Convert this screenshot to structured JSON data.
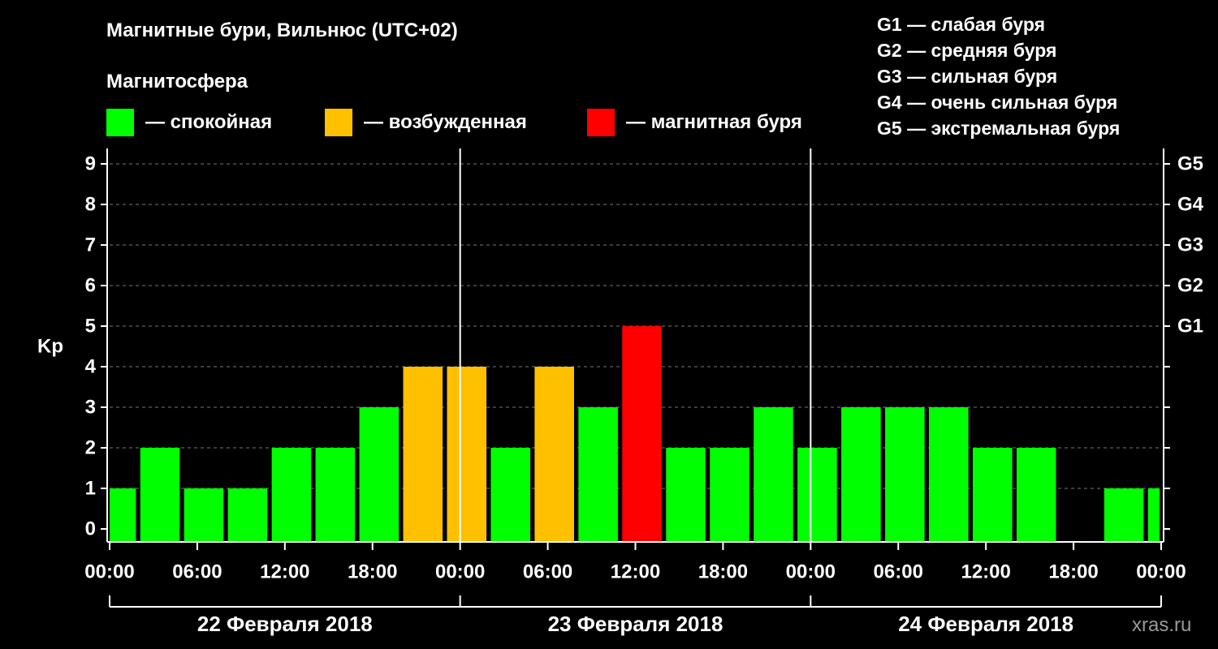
{
  "header": {
    "title": "Магнитные бури, Вильнюс (UTC+02)",
    "subtitle": "Магнитосфера"
  },
  "legend": [
    {
      "label": "— спокойная",
      "color": "#00ff00"
    },
    {
      "label": "— возбужденная",
      "color": "#ffc000"
    },
    {
      "label": "— магнитная буря",
      "color": "#ff0000"
    }
  ],
  "storm_levels": [
    "G1 — слабая буря",
    "G2 — средняя буря",
    "G3 — сильная буря",
    "G4 — очень сильная буря",
    "G5 — экстремальная буря"
  ],
  "watermark": "xras.ru",
  "chart_data": {
    "type": "bar",
    "ylabel": "Kp",
    "ylim": [
      0,
      9
    ],
    "yticks": [
      0,
      1,
      2,
      3,
      4,
      5,
      6,
      7,
      8,
      9
    ],
    "right_ticks": [
      {
        "value": 5,
        "label": "G1"
      },
      {
        "value": 6,
        "label": "G2"
      },
      {
        "value": 7,
        "label": "G3"
      },
      {
        "value": 8,
        "label": "G4"
      },
      {
        "value": 9,
        "label": "G5"
      }
    ],
    "xlim_hours": [
      0,
      72
    ],
    "xtick_labels": [
      "00:00",
      "06:00",
      "12:00",
      "18:00",
      "00:00",
      "06:00",
      "12:00",
      "18:00",
      "00:00",
      "06:00",
      "12:00",
      "18:00",
      "00:00"
    ],
    "days": [
      "22 Февраля 2018",
      "23 Февраля 2018",
      "24 Февраля 2018"
    ],
    "grid": "dashed horizontal",
    "colors": {
      "quiet": "#00ff00",
      "active": "#ffc000",
      "storm": "#ff0000"
    },
    "bars": [
      {
        "start": 0,
        "end": 1.8,
        "kp": 1,
        "class": "quiet"
      },
      {
        "start": 2.1,
        "end": 4.8,
        "kp": 2,
        "class": "quiet"
      },
      {
        "start": 5.1,
        "end": 7.8,
        "kp": 1,
        "class": "quiet"
      },
      {
        "start": 8.1,
        "end": 10.8,
        "kp": 1,
        "class": "quiet"
      },
      {
        "start": 11.1,
        "end": 13.8,
        "kp": 2,
        "class": "quiet"
      },
      {
        "start": 14.1,
        "end": 16.8,
        "kp": 2,
        "class": "quiet"
      },
      {
        "start": 17.1,
        "end": 19.8,
        "kp": 3,
        "class": "quiet"
      },
      {
        "start": 20.1,
        "end": 22.8,
        "kp": 4,
        "class": "active"
      },
      {
        "start": 23.1,
        "end": 25.8,
        "kp": 4,
        "class": "active"
      },
      {
        "start": 26.1,
        "end": 28.8,
        "kp": 2,
        "class": "quiet"
      },
      {
        "start": 29.1,
        "end": 31.8,
        "kp": 4,
        "class": "active"
      },
      {
        "start": 32.1,
        "end": 34.8,
        "kp": 3,
        "class": "quiet"
      },
      {
        "start": 35.1,
        "end": 37.8,
        "kp": 5,
        "class": "storm"
      },
      {
        "start": 38.1,
        "end": 40.8,
        "kp": 2,
        "class": "quiet"
      },
      {
        "start": 41.1,
        "end": 43.8,
        "kp": 2,
        "class": "quiet"
      },
      {
        "start": 44.1,
        "end": 46.8,
        "kp": 3,
        "class": "quiet"
      },
      {
        "start": 47.1,
        "end": 49.8,
        "kp": 2,
        "class": "quiet"
      },
      {
        "start": 50.1,
        "end": 52.8,
        "kp": 3,
        "class": "quiet"
      },
      {
        "start": 53.1,
        "end": 55.8,
        "kp": 3,
        "class": "quiet"
      },
      {
        "start": 56.1,
        "end": 58.8,
        "kp": 3,
        "class": "quiet"
      },
      {
        "start": 59.1,
        "end": 61.8,
        "kp": 2,
        "class": "quiet"
      },
      {
        "start": 62.1,
        "end": 64.8,
        "kp": 2,
        "class": "quiet"
      },
      {
        "start": 68.1,
        "end": 70.8,
        "kp": 1,
        "class": "quiet"
      },
      {
        "start": 71.1,
        "end": 71.9,
        "kp": 1,
        "class": "quiet"
      }
    ]
  }
}
